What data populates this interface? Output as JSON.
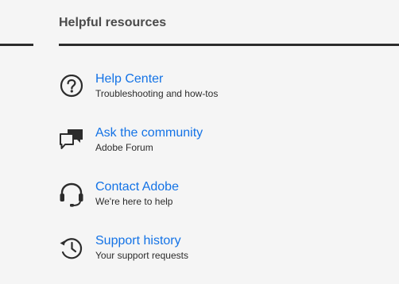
{
  "section": {
    "title": "Helpful resources"
  },
  "resources": [
    {
      "title": "Help Center",
      "description": "Troubleshooting and how-tos",
      "icon": "help-circle-icon"
    },
    {
      "title": "Ask the community",
      "description": "Adobe Forum",
      "icon": "chat-bubbles-icon"
    },
    {
      "title": "Contact Adobe",
      "description": "We're here to help",
      "icon": "headset-icon"
    },
    {
      "title": "Support history",
      "description": "Your support requests",
      "icon": "history-clock-icon"
    }
  ],
  "colors": {
    "background": "#f5f5f5",
    "link": "#1473e6",
    "text": "#2c2c2c",
    "heading": "#4b4b4b",
    "rule": "#2c2c2c"
  }
}
